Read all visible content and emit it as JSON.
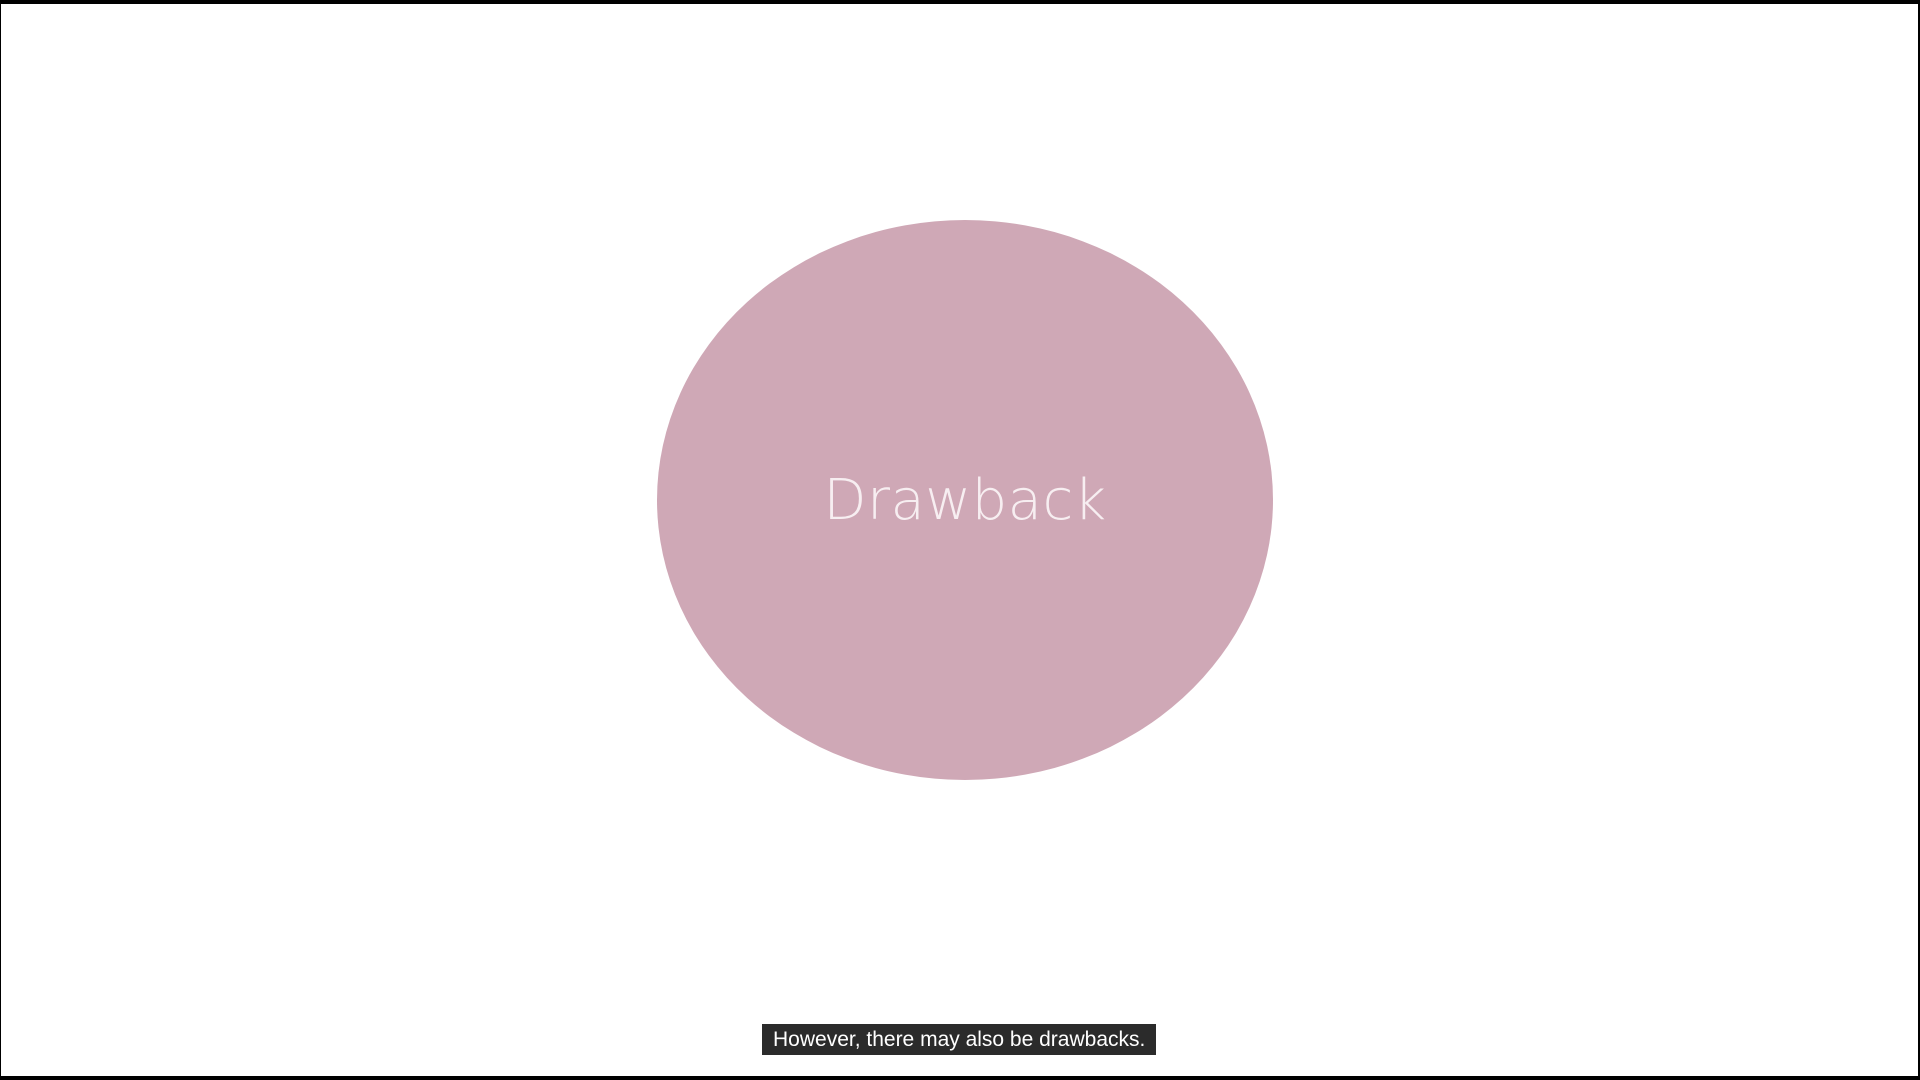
{
  "slide": {
    "circle_label": "Drawback",
    "circle_color": "#cfa8b6",
    "background_color": "#ffffff"
  },
  "subtitle": {
    "text": "However, there may also be drawbacks.",
    "background_color": "#2b2b2b"
  }
}
